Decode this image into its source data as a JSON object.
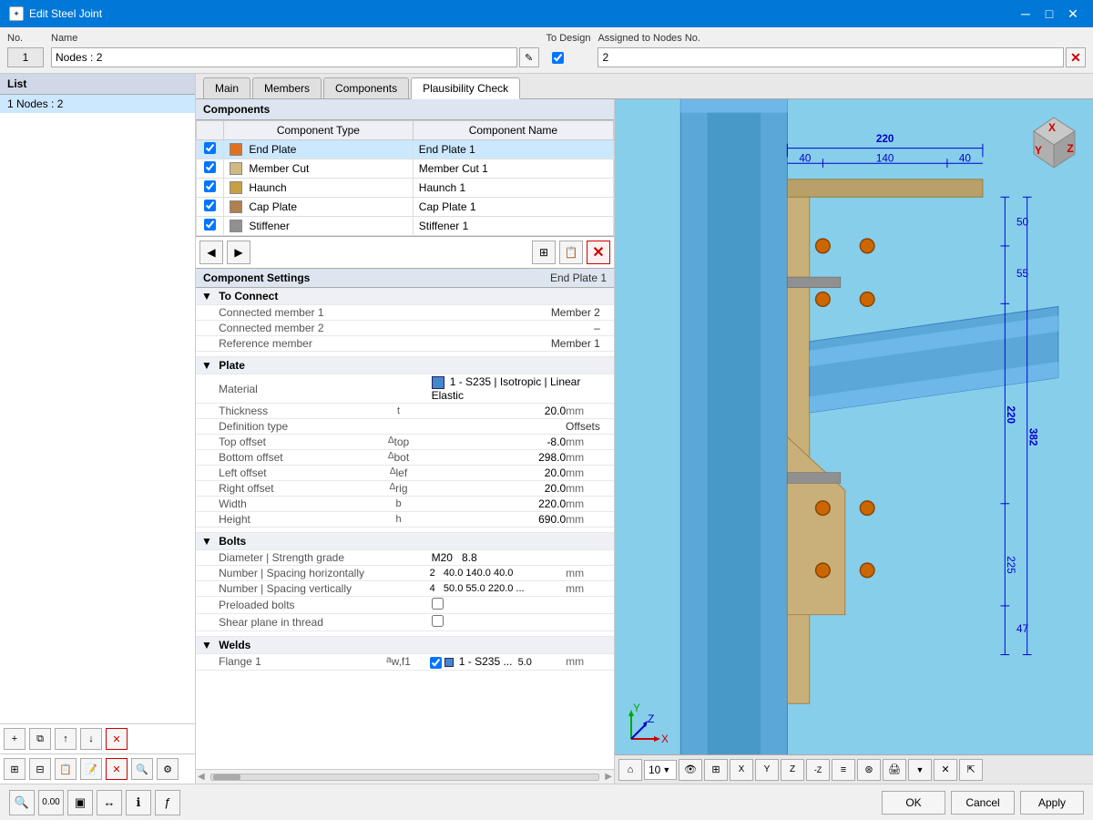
{
  "titleBar": {
    "title": "Edit Steel Joint",
    "controls": [
      "minimize",
      "maximize",
      "close"
    ]
  },
  "topPanel": {
    "noLabel": "No.",
    "noValue": "1",
    "nameLabel": "Name",
    "nameValue": "Nodes : 2",
    "toDesignLabel": "To Design",
    "toDesignChecked": true,
    "assignedLabel": "Assigned to Nodes No.",
    "assignedValue": "2"
  },
  "tabs": [
    "Main",
    "Members",
    "Components",
    "Plausibility Check"
  ],
  "activeTab": "Components",
  "listPanel": {
    "header": "List",
    "items": [
      {
        "id": 1,
        "label": "1  Nodes : 2",
        "selected": true
      }
    ]
  },
  "componentsSection": {
    "header": "Components",
    "tableHeaders": [
      "Component Type",
      "Component Name"
    ],
    "rows": [
      {
        "checked": true,
        "color": "swatch-orange",
        "type": "End Plate",
        "name": "End Plate 1"
      },
      {
        "checked": true,
        "color": "swatch-tan",
        "type": "Member Cut",
        "name": "Member Cut 1"
      },
      {
        "checked": true,
        "color": "swatch-gold",
        "type": "Haunch",
        "name": "Haunch 1"
      },
      {
        "checked": true,
        "color": "swatch-brown",
        "type": "Cap Plate",
        "name": "Cap Plate 1"
      },
      {
        "checked": true,
        "color": "swatch-gray",
        "type": "Stiffener",
        "name": "Stiffener 1"
      }
    ]
  },
  "componentSettings": {
    "header": "Component Settings",
    "name": "End Plate 1",
    "sections": {
      "toConnect": {
        "label": "To Connect",
        "properties": [
          {
            "label": "Connected member 1",
            "value": "Member 2",
            "unit": ""
          },
          {
            "label": "Connected member 2",
            "value": "–",
            "unit": ""
          },
          {
            "label": "Reference member",
            "value": "Member 1",
            "unit": ""
          }
        ]
      },
      "plate": {
        "label": "Plate",
        "properties": [
          {
            "label": "Material",
            "value": "1 - S235 | Isotropic | Linear Elastic",
            "unit": "",
            "hasSwatch": true
          },
          {
            "label": "Thickness",
            "symbol": "t",
            "value": "20.0",
            "unit": "mm"
          },
          {
            "label": "Definition type",
            "value": "Offsets",
            "unit": ""
          },
          {
            "label": "Top offset",
            "symbol": "Δtop",
            "value": "-8.0",
            "unit": "mm"
          },
          {
            "label": "Bottom offset",
            "symbol": "Δbot",
            "value": "298.0",
            "unit": "mm"
          },
          {
            "label": "Left offset",
            "symbol": "Δlef",
            "value": "20.0",
            "unit": "mm"
          },
          {
            "label": "Right offset",
            "symbol": "Δrig",
            "value": "20.0",
            "unit": "mm"
          },
          {
            "label": "Width",
            "symbol": "b",
            "value": "220.0",
            "unit": "mm"
          },
          {
            "label": "Height",
            "symbol": "h",
            "value": "690.0",
            "unit": "mm"
          }
        ]
      },
      "bolts": {
        "label": "Bolts",
        "properties": [
          {
            "label": "Diameter | Strength grade",
            "value": "M20   8.8",
            "unit": ""
          },
          {
            "label": "Number | Spacing horizontally",
            "value": "2     40.0 140.0 40.0",
            "unit": "mm"
          },
          {
            "label": "Number | Spacing vertically",
            "value": "4     50.0 55.0 220.0 ...",
            "unit": "mm"
          },
          {
            "label": "Preloaded bolts",
            "value": "",
            "unit": "",
            "hasCheckbox": true
          },
          {
            "label": "Shear plane in thread",
            "value": "",
            "unit": "",
            "hasCheckbox": true
          }
        ]
      },
      "welds": {
        "label": "Welds",
        "properties": [
          {
            "label": "Flange 1",
            "symbol": "aw,f1",
            "value": "1 - S235 ...",
            "numValue": "5.0",
            "unit": "mm",
            "hasIndicator": true
          }
        ]
      }
    }
  },
  "bottomBar": {
    "okLabel": "OK",
    "cancelLabel": "Cancel",
    "applyLabel": "Apply"
  },
  "viewDimensions": {
    "top": "220",
    "seg1": "40",
    "seg2": "140",
    "seg3": "40",
    "d1": "50",
    "d2": "55",
    "d3": "220",
    "d4": "225",
    "d5": "47",
    "rightDim": "382"
  }
}
